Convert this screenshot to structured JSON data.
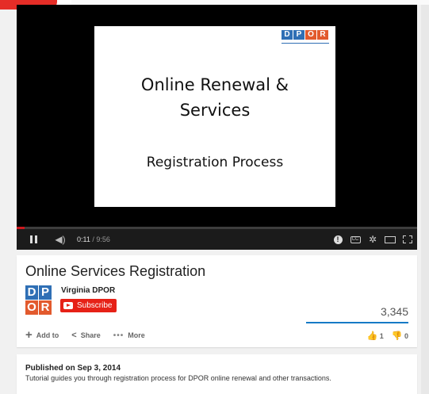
{
  "player": {
    "slide": {
      "logo_letters": [
        "D",
        "P",
        "O",
        "R"
      ],
      "title_line1": "Online Renewal &",
      "title_line2": "Services",
      "subtitle": "Registration Process"
    },
    "progress": 0.0189,
    "current_time": "0:11",
    "duration": "/ 9:56",
    "icons": [
      "pause-icon",
      "volume-icon",
      "info-icon",
      "captions-icon",
      "settings-icon",
      "theater-icon",
      "fullscreen-icon"
    ],
    "colors": {
      "progress_played": "#cc181e",
      "control_bar": "#1b1b1b"
    }
  },
  "video": {
    "title": "Online Services Registration",
    "channel": "Virginia DPOR",
    "subscribe_label": "Subscribe",
    "views": "3,345",
    "add_to_label": "Add to",
    "share_label": "Share",
    "more_label": "More",
    "likes": "1",
    "dislikes": "0"
  },
  "description": {
    "published": "Published on Sep 3, 2014",
    "text": "Tutorial guides you through registration process for DPOR online renewal and other transactions."
  },
  "colors": {
    "brand_red": "#e62117",
    "views_bar": "#167ac6",
    "dpor_blue": "#2f6fb5",
    "dpor_orange": "#e25a2d"
  }
}
